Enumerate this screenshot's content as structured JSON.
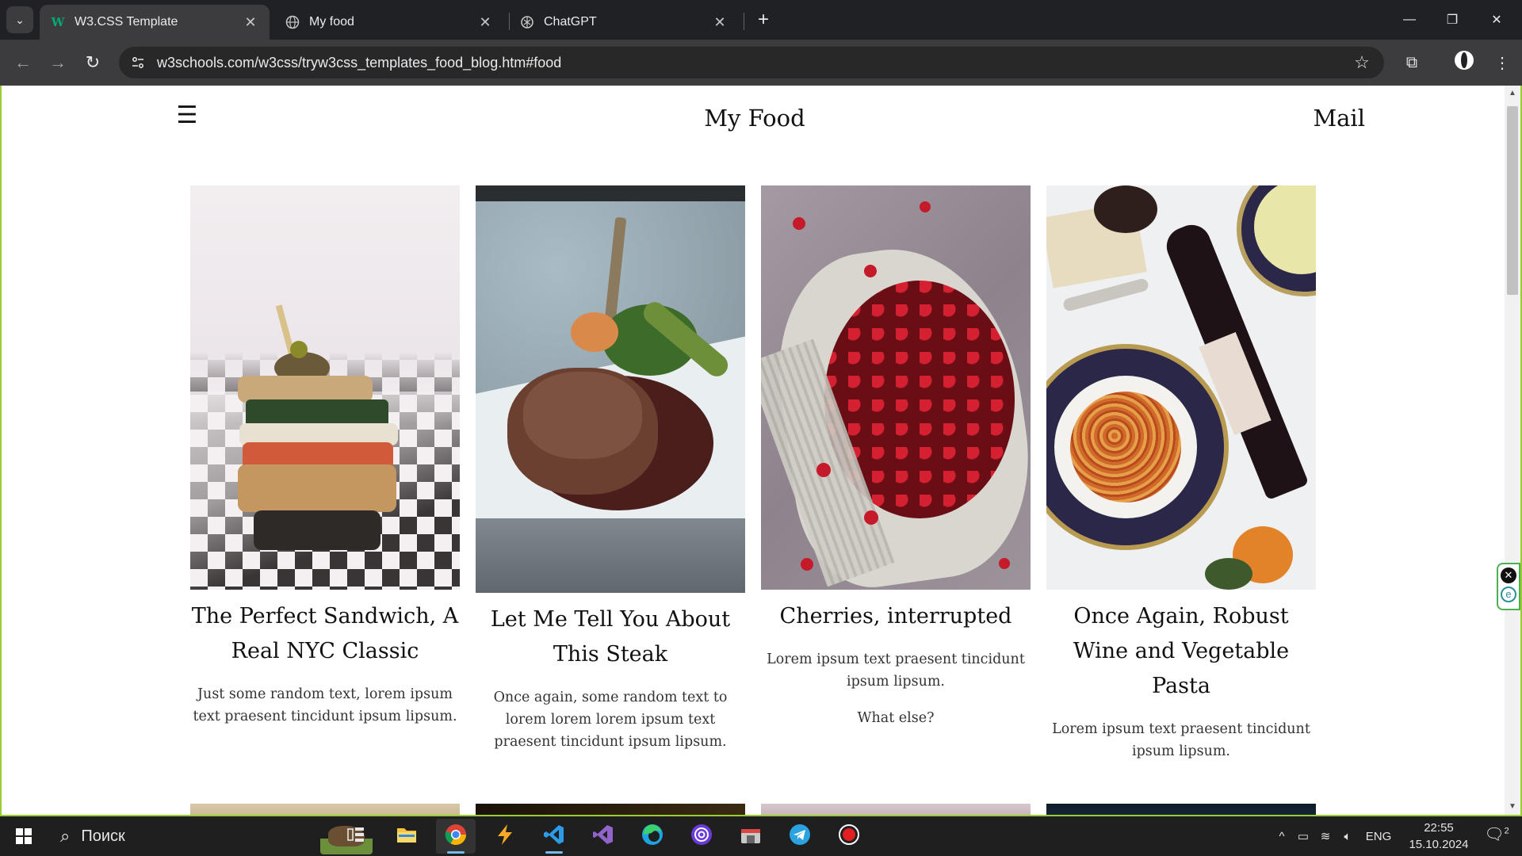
{
  "browser": {
    "tabs": [
      {
        "title": "W3.CSS Template",
        "icon": "w3schools-favicon",
        "active": true
      },
      {
        "title": "My food",
        "icon": "globe-icon",
        "active": false
      },
      {
        "title": "ChatGPT",
        "icon": "chatgpt-icon",
        "active": false
      }
    ],
    "url": "w3schools.com/w3css/tryw3css_templates_food_blog.htm#food"
  },
  "site": {
    "menu_icon": "☰",
    "title": "My Food",
    "mail": "Mail"
  },
  "posts": [
    {
      "title": "The Perfect Sandwich, A Real NYC Classic",
      "text": "Just some random text, lorem ipsum text praesent tincidunt ipsum lipsum.",
      "image": "sandwich"
    },
    {
      "title": "Let Me Tell You About This Steak",
      "text": "Once again, some random text to lorem lorem lorem ipsum text praesent tincidunt ipsum lipsum.",
      "image": "steak"
    },
    {
      "title": "Cherries, interrupted",
      "text": "Lorem ipsum text praesent tincidunt ipsum lipsum.",
      "text2": "What else?",
      "image": "cherries"
    },
    {
      "title": "Once Again, Robust Wine and Vegetable Pasta",
      "text": "Lorem ipsum text praesent tincidunt ipsum lipsum.",
      "image": "wine-pasta"
    }
  ],
  "taskbar": {
    "search_label": "Поиск",
    "language": "ENG",
    "time": "22:55",
    "date": "15.10.2024",
    "notifications": "2"
  },
  "colors": {
    "accent_frame": "#9acd32",
    "chrome_dark": "#202124",
    "toolbar": "#3c3c3f"
  }
}
